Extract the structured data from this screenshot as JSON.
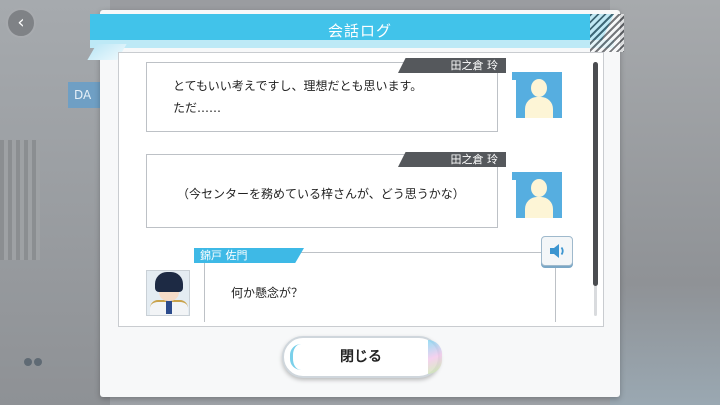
{
  "dialog": {
    "title": "会話ログ",
    "close_label": "閉じる"
  },
  "log": [
    {
      "speaker": "田之倉 玲",
      "line1": "とてもいい考えですし、理想だとも思います。",
      "line2": "ただ……"
    },
    {
      "speaker": "田之倉 玲",
      "line1": "（今センターを務めている梓さんが、どう思うかな）"
    },
    {
      "speaker": "錦戸 佐門",
      "line1": "何か懸念が？"
    }
  ],
  "background": {
    "tab_text": "DA"
  },
  "colors": {
    "accent": "#41c3ea",
    "nametag_dark": "#55585c",
    "avatar_blue": "#56aee0"
  },
  "icons": [
    "back-arrow-icon",
    "speaker-icon",
    "silhouette-avatar-icon"
  ]
}
